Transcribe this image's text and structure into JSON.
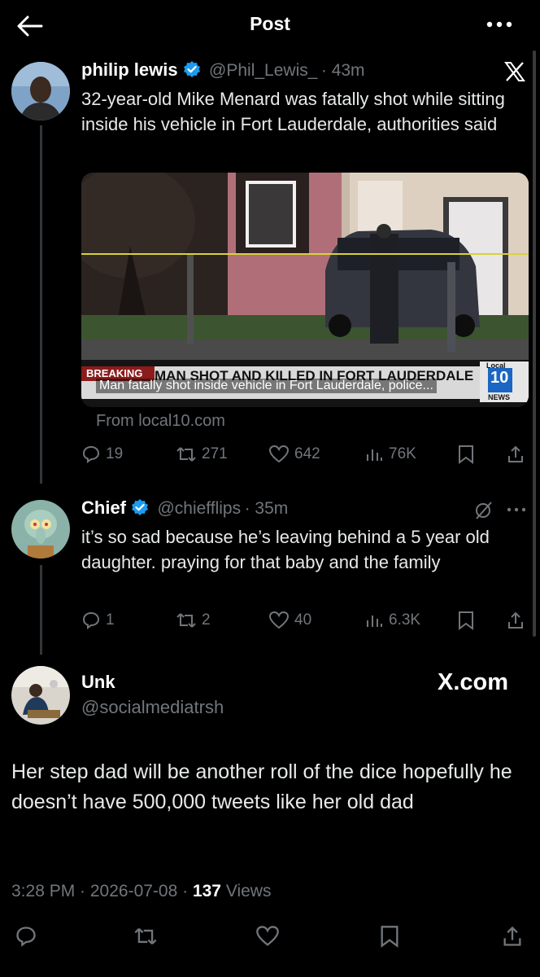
{
  "header": {
    "title": "Post",
    "back_icon": "arrow-left-icon",
    "more_icon": "more-horizontal-icon"
  },
  "tweet1": {
    "name": "philip lewis",
    "handle": "@Phil_Lewis_",
    "time": "· 43m",
    "text": "32-year-old Mike Menard was fatally shot while sitting inside his vehicle in Fort Lauderdale, authorities said",
    "media": {
      "caption_overlay": "Man fatally shot inside vehicle in Fort Lauderdale, police...",
      "banner_breaking": "BREAKING",
      "banner_text": "MAN SHOT AND KILLED IN FORT LAUDERDALE",
      "logo_top": "Local",
      "logo_num": "10",
      "logo_bottom": "NEWS"
    },
    "source": "From local10.com",
    "stats": {
      "replies": "19",
      "reposts": "271",
      "likes": "642",
      "views": "76K"
    }
  },
  "tweet2": {
    "name": "Chief",
    "handle": "@chiefflips",
    "time": "· 35m",
    "text": "it’s so sad because he’s leaving behind a 5 year old daughter. praying for that baby and the family",
    "stats": {
      "replies": "1",
      "reposts": "2",
      "likes": "40",
      "views": "6.3K"
    }
  },
  "reply": {
    "name": "Unk",
    "handle": "@socialmediatrsh",
    "text": "Her step dad will be another roll of the dice hopefully he doesn’t have 500,000 tweets like her old dad",
    "time": "3:28 PM · 2026-07-08 · ",
    "views_count": "137",
    "views_label": " Views"
  },
  "watermark": "X.com",
  "colors": {
    "bg": "#000000",
    "verified": "#1d9bf0",
    "muted": "#71767b",
    "text": "#e7e9ea"
  }
}
